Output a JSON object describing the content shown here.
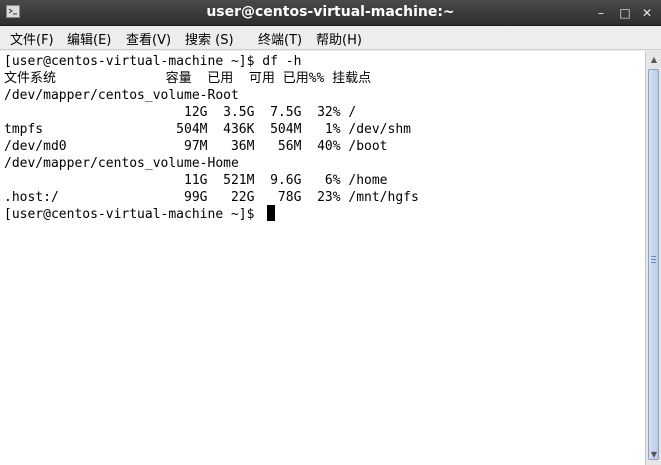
{
  "window": {
    "title": "user@centos-virtual-machine:~",
    "icon": "terminal-icon"
  },
  "controls": {
    "minimize": "–",
    "maximize": "□",
    "close": "✕"
  },
  "menu": [
    {
      "label": "文件(F)"
    },
    {
      "label": "编辑(E)"
    },
    {
      "label": "查看(V)"
    },
    {
      "label": "搜索 (S)"
    },
    {
      "label": "终端(T)"
    },
    {
      "label": "帮助(H)"
    }
  ],
  "terminal": {
    "lines": [
      "[user@centos-virtual-machine ~]$ df -h",
      "文件系统              容量  已用  可用 已用%% 挂载点",
      "/dev/mapper/centos_volume-Root",
      "                       12G  3.5G  7.5G  32% /",
      "tmpfs                 504M  436K  504M   1% /dev/shm",
      "/dev/md0               97M   36M   56M  40% /boot",
      "/dev/mapper/centos_volume-Home",
      "                       11G  521M  9.6G   6% /home",
      ".host:/                99G   22G   78G  23% /mnt/hgfs",
      "[user@centos-virtual-machine ~]$"
    ]
  },
  "scrollbar": {
    "up": "▲",
    "down": "▼"
  }
}
